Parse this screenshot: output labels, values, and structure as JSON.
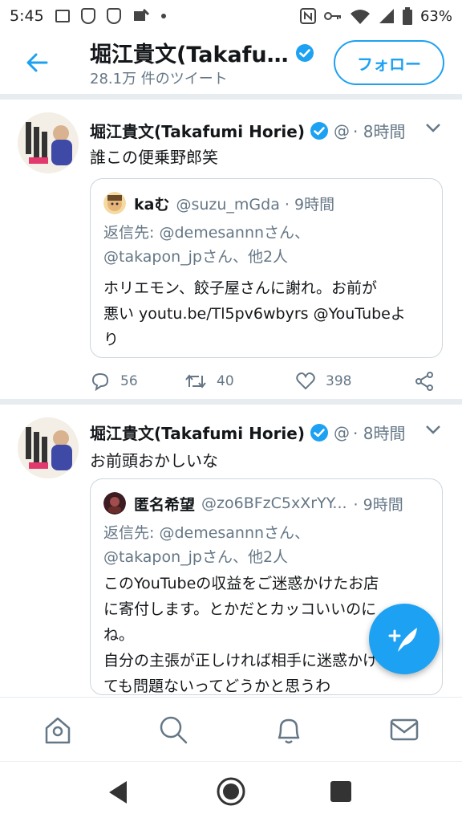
{
  "status_bar": {
    "time": "5:45",
    "battery": "63%"
  },
  "header": {
    "title": "堀江貴文(Takafu…",
    "subtitle": "28.1万 件のツイート",
    "follow_label": "フォロー"
  },
  "tweets": [
    {
      "name": "堀江貴文(Takafumi Horie)",
      "handle": "@",
      "time": "· 8時間",
      "text": "誰この便乗野郎笑",
      "quote": {
        "name": "kaむ",
        "handle": "@suzu_mGda · 9時間",
        "reply_line1": "返信先: @demesannnさん、",
        "reply_line2": "@takapon_jpさん、他2人",
        "text_lines": [
          "ホリエモン、餃子屋さんに謝れ。お前が",
          "悪い youtu.be/Tl5pv6wbyrs @YouTubeよ",
          "り"
        ]
      },
      "replies": "56",
      "retweets": "40",
      "likes": "398"
    },
    {
      "name": "堀江貴文(Takafumi Horie)",
      "handle": "@",
      "time": "· 8時間",
      "text": "お前頭おかしいな",
      "quote": {
        "name": "匿名希望",
        "handle": "@zo6BFzC5xXrYY...",
        "time": "· 9時間",
        "reply_line1": "返信先: @demesannnさん、",
        "reply_line2": "@takapon_jpさん、他2人",
        "text_lines": [
          "このYouTubeの収益をご迷惑かけたお店",
          "に寄付します。とかだとカッコいいのに",
          "ね。",
          "自分の主張が正しければ相手に迷惑かけ",
          "ても問題ないってどうかと思うわ"
        ]
      }
    }
  ],
  "icons": {
    "back": "arrow-left-icon",
    "verified": "verified-badge-icon",
    "reply": "reply-icon",
    "retweet": "retweet-icon",
    "like": "heart-icon",
    "share": "share-icon",
    "compose": "compose-tweet-icon",
    "home": "home-icon",
    "search": "search-icon",
    "notifications": "bell-icon",
    "messages": "mail-icon"
  },
  "colors": {
    "accent": "#1da1f2",
    "muted": "#657786",
    "text": "#14171a"
  }
}
